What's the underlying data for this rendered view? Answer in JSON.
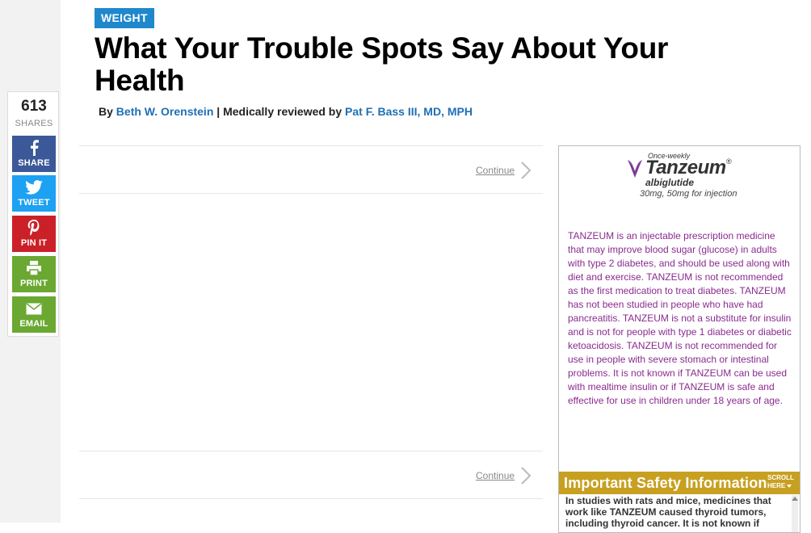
{
  "share": {
    "count": "613",
    "count_label": "SHARES",
    "buttons": [
      {
        "label": "SHARE",
        "icon": "facebook-icon"
      },
      {
        "label": "TWEET",
        "icon": "twitter-icon"
      },
      {
        "label": "PIN IT",
        "icon": "pinterest-icon"
      },
      {
        "label": "PRINT",
        "icon": "print-icon"
      },
      {
        "label": "EMAIL",
        "icon": "email-icon"
      }
    ]
  },
  "article": {
    "category": "WEIGHT",
    "title": "What Your Trouble Spots Say About Your Health",
    "byline": {
      "by_prefix": "By",
      "author": "Beth W. Orenstein",
      "separator": "|",
      "reviewed_prefix": "Medically reviewed by",
      "reviewer": "Pat F. Bass III, MD, MPH"
    },
    "continue_label": "Continue"
  },
  "ad": {
    "once_weekly": "Once-weekly",
    "brand": "Tanzeum",
    "registered": "®",
    "generic": "albiglutide",
    "dose": "30mg, 50mg for injection",
    "body": "TANZEUM is an injectable prescription medicine that may improve blood sugar (glucose) in adults with type 2 diabetes, and should be used along with diet and exercise. TANZEUM is not recommended as the first medication to treat diabetes. TANZEUM has not been studied in people who have had pancreatitis. TANZEUM is not a substitute for insulin and is not for people with type 1 diabetes or diabetic ketoacidosis. TANZEUM is not recommended for use in people with severe stomach or intestinal problems. It is not known if TANZEUM can be used with mealtime insulin or if TANZEUM is safe and effective for use in children under 18 years of age.",
    "isi_title": "Important Safety Information",
    "scroll_line1": "SCROLL",
    "scroll_line2": "HERE",
    "isi_body": "In studies with rats and mice, medicines that work like TANZEUM caused thyroid tumors, including thyroid cancer. It is not known if",
    "colors": {
      "body_text": "#8a2b8f",
      "isi_bar": "#c8a021"
    }
  },
  "colors": {
    "category_badge": "#1f88cc",
    "link": "#1f6fb5"
  }
}
